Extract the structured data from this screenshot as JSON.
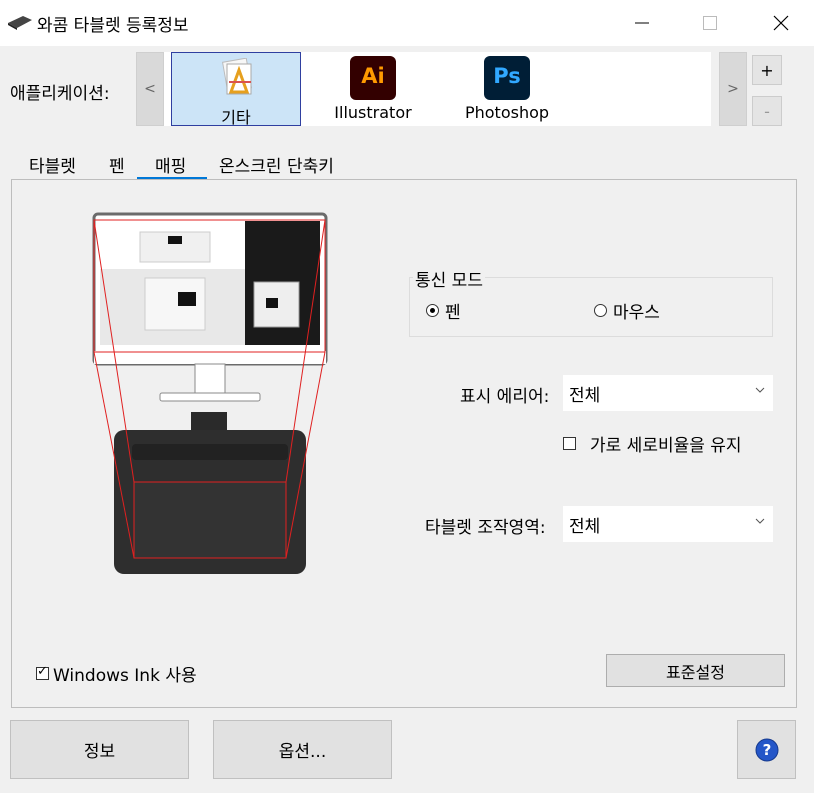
{
  "window": {
    "title": "와콤 타블렛 등록정보"
  },
  "apps": {
    "label": "애플리케이션:",
    "prev": "<",
    "next": ">",
    "add": "+",
    "remove": "-",
    "items": [
      {
        "label": "기타",
        "icon": "other-app-icon",
        "selected": true
      },
      {
        "label": "Illustrator",
        "icon": "illustrator-icon",
        "badge": "Ai",
        "color": "#ff9a00"
      },
      {
        "label": "Photoshop",
        "icon": "photoshop-icon",
        "badge": "Ps",
        "color": "#31a8ff"
      }
    ]
  },
  "tabs": [
    {
      "label": "타블렛",
      "active": false
    },
    {
      "label": "펜",
      "active": false
    },
    {
      "label": "매핑",
      "active": true
    },
    {
      "label": "온스크린 단축키",
      "active": false
    }
  ],
  "mapping": {
    "mode_group": "통신 모드",
    "mode_pen": "펜",
    "mode_mouse": "마우스",
    "mode_selected": "pen",
    "display_area_label": "표시 에리어:",
    "display_area_value": "전체",
    "keep_ratio_label": "가로 세로비율을 유지",
    "keep_ratio_checked": false,
    "tablet_area_label": "타블렛 조작영역:",
    "tablet_area_value": "전체",
    "windows_ink_label": "Windows Ink 사용",
    "windows_ink_checked": true,
    "defaults_button": "표준설정"
  },
  "footer": {
    "about": "정보",
    "options": "옵션...",
    "help_icon": "help-icon"
  },
  "colors": {
    "accent": "#0078d7",
    "mapping_line": "#e02020",
    "help": "#2456c8"
  }
}
